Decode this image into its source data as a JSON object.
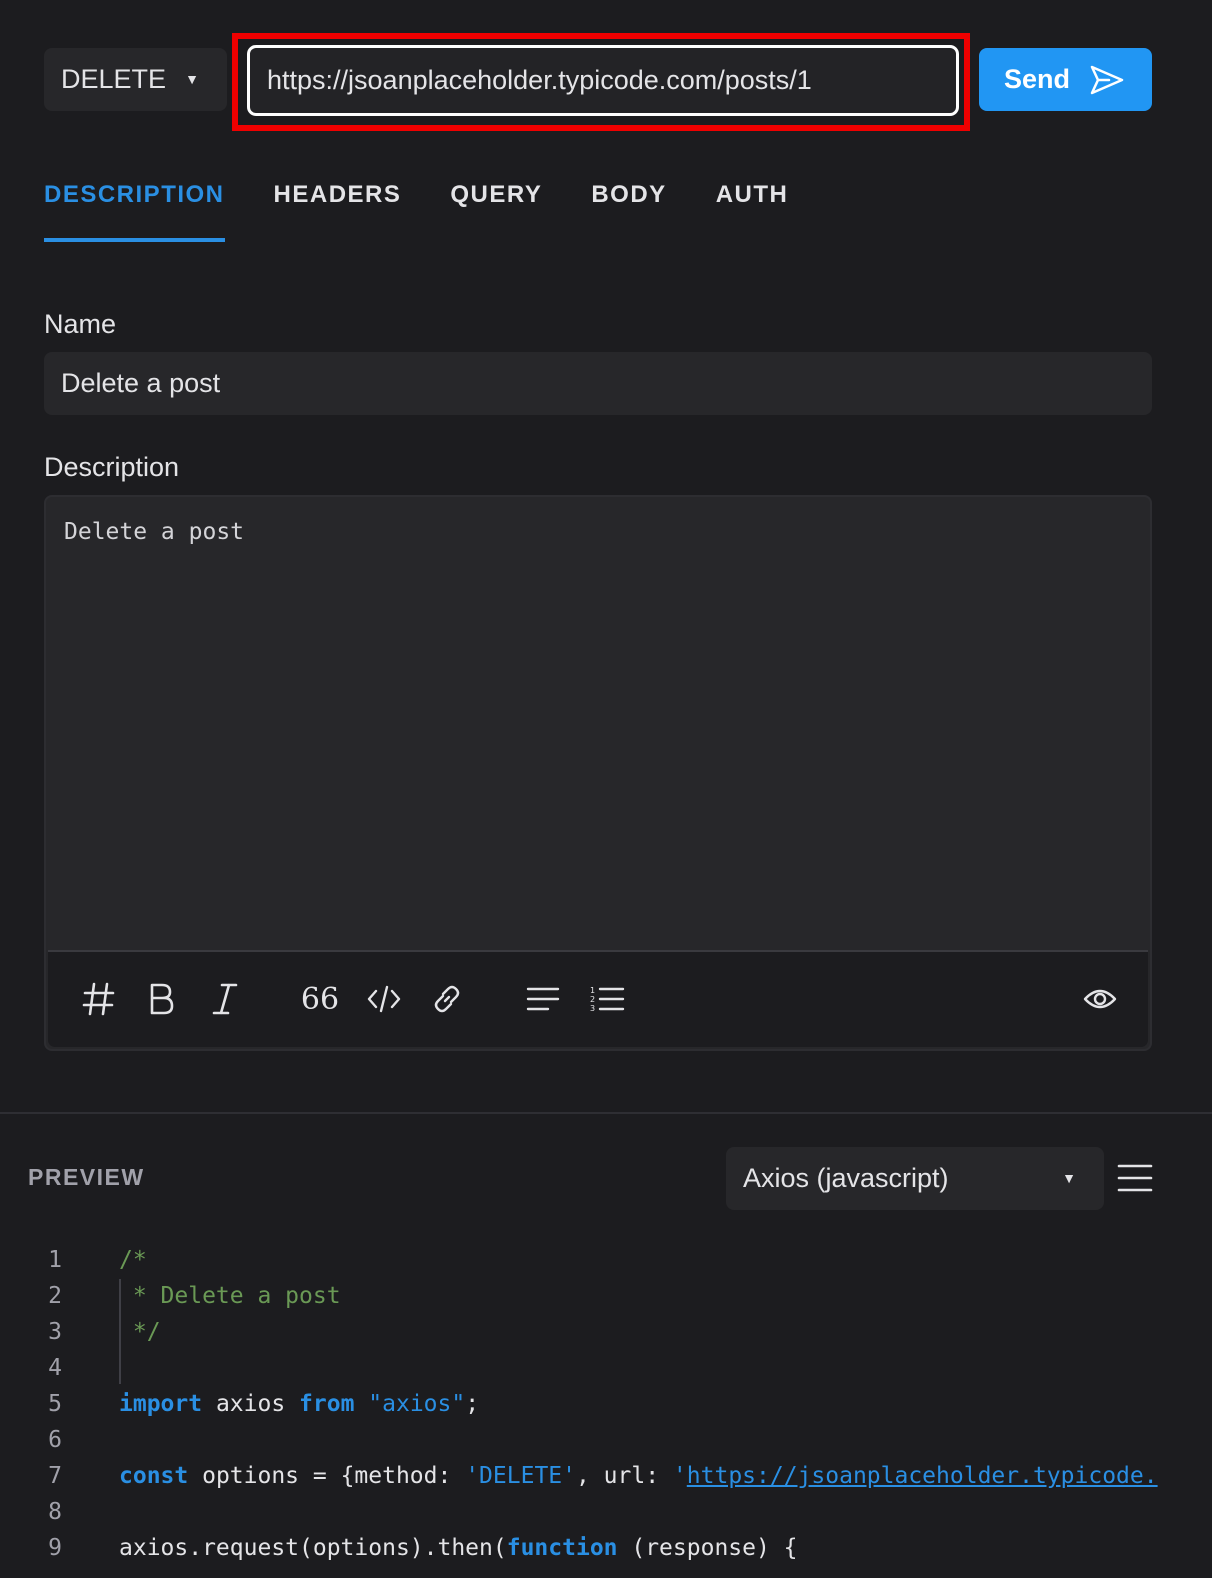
{
  "request": {
    "method": "DELETE",
    "url": "https://jsoanplaceholder.typicode.com/posts/1",
    "send_label": "Send"
  },
  "tabs": [
    {
      "label": "DESCRIPTION",
      "active": true
    },
    {
      "label": "HEADERS",
      "active": false
    },
    {
      "label": "QUERY",
      "active": false
    },
    {
      "label": "BODY",
      "active": false
    },
    {
      "label": "AUTH",
      "active": false
    }
  ],
  "form": {
    "name_label": "Name",
    "name_value": "Delete a post",
    "description_label": "Description",
    "description_value": "Delete a post"
  },
  "toolbar_icons": [
    "heading-icon",
    "bold-icon",
    "italic-icon",
    "quote-icon",
    "code-icon",
    "link-icon",
    "bullet-list-icon",
    "numbered-list-icon",
    "preview-eye-icon"
  ],
  "preview": {
    "label": "PREVIEW",
    "language": "Axios (javascript)",
    "lines": [
      {
        "n": "1",
        "parts": [
          {
            "t": "/*",
            "c": "comment"
          }
        ]
      },
      {
        "n": "2",
        "parts": [
          {
            "t": " * Delete a post",
            "c": "comment"
          }
        ]
      },
      {
        "n": "3",
        "parts": [
          {
            "t": " */",
            "c": "comment"
          }
        ]
      },
      {
        "n": "4",
        "parts": []
      },
      {
        "n": "5",
        "parts": [
          {
            "t": "import",
            "c": "kw"
          },
          {
            "t": " axios ",
            "c": ""
          },
          {
            "t": "from",
            "c": "kw"
          },
          {
            "t": " ",
            "c": ""
          },
          {
            "t": "\"axios\"",
            "c": "str"
          },
          {
            "t": ";",
            "c": ""
          }
        ]
      },
      {
        "n": "6",
        "parts": []
      },
      {
        "n": "7",
        "parts": [
          {
            "t": "const",
            "c": "kw"
          },
          {
            "t": " options = {method: ",
            "c": ""
          },
          {
            "t": "'DELETE'",
            "c": "str"
          },
          {
            "t": ", url: ",
            "c": ""
          },
          {
            "t": "'",
            "c": "str"
          },
          {
            "t": "https://jsoanplaceholder.typicode.",
            "c": "link"
          }
        ]
      },
      {
        "n": "8",
        "parts": []
      },
      {
        "n": "9",
        "parts": [
          {
            "t": "axios.request(options).then(",
            "c": ""
          },
          {
            "t": "function",
            "c": "kw"
          },
          {
            "t": " (response) {",
            "c": ""
          }
        ]
      }
    ]
  },
  "colors": {
    "accent": "#2196f3",
    "highlight_border": "#ef0000",
    "background": "#1c1c1f",
    "panel": "#27272a"
  }
}
